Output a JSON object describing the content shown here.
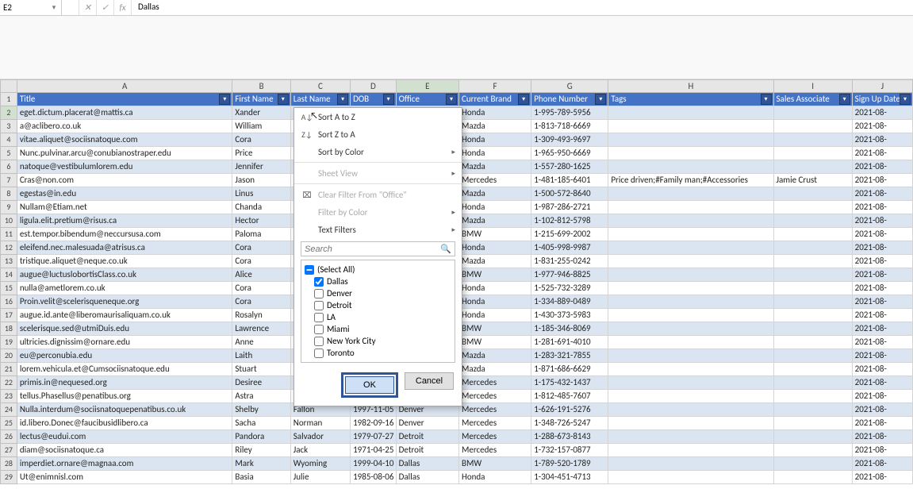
{
  "formula": {
    "name_box": "E2",
    "value": "Dallas"
  },
  "columns": [
    "A",
    "B",
    "C",
    "D",
    "E",
    "F",
    "G",
    "H",
    "I",
    "J"
  ],
  "headers": [
    "Title",
    "First Name",
    "Last Name",
    "DOB",
    "Office",
    "Current Brand",
    "Phone Number",
    "Tags",
    "Sales Associate",
    "Sign Up Date"
  ],
  "rows": [
    {
      "n": 2,
      "title": "eget.dictum.placerat@mattis.ca",
      "fn": "Xander",
      "ln": "",
      "dob": "",
      "off": "",
      "brand": "Honda",
      "ph": "1-995-789-5956",
      "tags": "",
      "sa": "",
      "su": "2021-08-"
    },
    {
      "n": 3,
      "title": "a@aclibero.co.uk",
      "fn": "William",
      "ln": "",
      "dob": "",
      "off": "",
      "brand": "Mazda",
      "ph": "1-813-718-6669",
      "tags": "",
      "sa": "",
      "su": "2021-08-"
    },
    {
      "n": 4,
      "title": "vitae.aliquet@sociisnatoque.com",
      "fn": "Cora",
      "ln": "",
      "dob": "",
      "off": "",
      "brand": "Honda",
      "ph": "1-309-493-9697",
      "tags": "",
      "sa": "",
      "su": "2021-08-"
    },
    {
      "n": 5,
      "title": "Nunc.pulvinar.arcu@conubianostraper.edu",
      "fn": "Price",
      "ln": "",
      "dob": "",
      "off": "",
      "brand": "Honda",
      "ph": "1-965-950-6669",
      "tags": "",
      "sa": "",
      "su": "2021-08-"
    },
    {
      "n": 6,
      "title": "natoque@vestibulumlorem.edu",
      "fn": "Jennifer",
      "ln": "",
      "dob": "",
      "off": "",
      "brand": "Mazda",
      "ph": "1-557-280-1625",
      "tags": "",
      "sa": "",
      "su": "2021-08-"
    },
    {
      "n": 7,
      "title": "Cras@non.com",
      "fn": "Jason",
      "ln": "",
      "dob": "",
      "off": "",
      "brand": "Mercedes",
      "ph": "1-481-185-6401",
      "tags": "Price driven;#Family man;#Accessories",
      "sa": "Jamie Crust",
      "su": "2021-08-"
    },
    {
      "n": 8,
      "title": "egestas@in.edu",
      "fn": "Linus",
      "ln": "",
      "dob": "",
      "off": "",
      "brand": "Mazda",
      "ph": "1-500-572-8640",
      "tags": "",
      "sa": "",
      "su": "2021-08-"
    },
    {
      "n": 9,
      "title": "Nullam@Etiam.net",
      "fn": "Chanda",
      "ln": "",
      "dob": "",
      "off": "",
      "brand": "Honda",
      "ph": "1-987-286-2721",
      "tags": "",
      "sa": "",
      "su": "2021-08-"
    },
    {
      "n": 10,
      "title": "ligula.elit.pretium@risus.ca",
      "fn": "Hector",
      "ln": "",
      "dob": "",
      "off": "",
      "brand": "Mazda",
      "ph": "1-102-812-5798",
      "tags": "",
      "sa": "",
      "su": "2021-08-"
    },
    {
      "n": 11,
      "title": "est.tempor.bibendum@neccursusa.com",
      "fn": "Paloma",
      "ln": "",
      "dob": "",
      "off": "",
      "brand": "BMW",
      "ph": "1-215-699-2002",
      "tags": "",
      "sa": "",
      "su": "2021-08-"
    },
    {
      "n": 12,
      "title": "eleifend.nec.malesuada@atrisus.ca",
      "fn": "Cora",
      "ln": "",
      "dob": "",
      "off": "",
      "brand": "Honda",
      "ph": "1-405-998-9987",
      "tags": "",
      "sa": "",
      "su": "2021-08-"
    },
    {
      "n": 13,
      "title": "tristique.aliquet@neque.co.uk",
      "fn": "Cora",
      "ln": "",
      "dob": "",
      "off": "",
      "brand": "Mazda",
      "ph": "1-831-255-0242",
      "tags": "",
      "sa": "",
      "su": "2021-08-"
    },
    {
      "n": 14,
      "title": "augue@luctuslobortisClass.co.uk",
      "fn": "Alice",
      "ln": "",
      "dob": "",
      "off": "",
      "brand": "BMW",
      "ph": "1-977-946-8825",
      "tags": "",
      "sa": "",
      "su": "2021-08-"
    },
    {
      "n": 15,
      "title": "nulla@ametlorem.co.uk",
      "fn": "Cora",
      "ln": "",
      "dob": "",
      "off": "",
      "brand": "Honda",
      "ph": "1-525-732-3289",
      "tags": "",
      "sa": "",
      "su": "2021-08-"
    },
    {
      "n": 16,
      "title": "Proin.velit@scelerisqueneque.org",
      "fn": "Cora",
      "ln": "",
      "dob": "",
      "off": "",
      "brand": "Honda",
      "ph": "1-334-889-0489",
      "tags": "",
      "sa": "",
      "su": "2021-08-"
    },
    {
      "n": 17,
      "title": "augue.id.ante@liberomaurisaliquam.co.uk",
      "fn": "Rosalyn",
      "ln": "",
      "dob": "",
      "off": "",
      "brand": "Honda",
      "ph": "1-430-373-5983",
      "tags": "",
      "sa": "",
      "su": "2021-08-"
    },
    {
      "n": 18,
      "title": "scelerisque.sed@utmiDuis.edu",
      "fn": "Lawrence",
      "ln": "",
      "dob": "",
      "off": "",
      "brand": "BMW",
      "ph": "1-185-346-8069",
      "tags": "",
      "sa": "",
      "su": "2021-08-"
    },
    {
      "n": 19,
      "title": "ultricies.dignissim@ornare.edu",
      "fn": "Anne",
      "ln": "",
      "dob": "",
      "off": "",
      "brand": "BMW",
      "ph": "1-281-691-4010",
      "tags": "",
      "sa": "",
      "su": "2021-08-"
    },
    {
      "n": 20,
      "title": "eu@perconubia.edu",
      "fn": "Laith",
      "ln": "",
      "dob": "",
      "off": "",
      "brand": "Mazda",
      "ph": "1-283-321-7855",
      "tags": "",
      "sa": "",
      "su": "2021-08-"
    },
    {
      "n": 21,
      "title": "lorem.vehicula.et@Cumsociisnatoque.edu",
      "fn": "Stuart",
      "ln": "",
      "dob": "",
      "off": "",
      "brand": "Mazda",
      "ph": "1-871-686-6629",
      "tags": "",
      "sa": "",
      "su": "2021-08-"
    },
    {
      "n": 22,
      "title": "primis.in@nequesed.org",
      "fn": "Desiree",
      "ln": "",
      "dob": "",
      "off": "",
      "brand": "Mercedes",
      "ph": "1-175-432-1437",
      "tags": "",
      "sa": "",
      "su": "2021-08-"
    },
    {
      "n": 23,
      "title": "tellus.Phasellus@penatibus.org",
      "fn": "Astra",
      "ln": "",
      "dob": "",
      "off": "",
      "brand": "Mercedes",
      "ph": "1-812-485-7607",
      "tags": "",
      "sa": "",
      "su": "2021-08-"
    },
    {
      "n": 24,
      "title": "Nulla.interdum@sociisnatoquepenatibus.co.uk",
      "fn": "Shelby",
      "ln": "Fallon",
      "dob": "1997-11-05",
      "off": "Denver",
      "brand": "Mercedes",
      "ph": "1-626-191-5276",
      "tags": "",
      "sa": "",
      "su": "2021-08-"
    },
    {
      "n": 25,
      "title": "id.libero.Donec@faucibusidlibero.ca",
      "fn": "Sacha",
      "ln": "Norman",
      "dob": "1982-09-16",
      "off": "Denver",
      "brand": "Mercedes",
      "ph": "1-348-726-5247",
      "tags": "",
      "sa": "",
      "su": "2021-08-"
    },
    {
      "n": 26,
      "title": "lectus@eudui.com",
      "fn": "Pandora",
      "ln": "Salvador",
      "dob": "1979-07-27",
      "off": "Detroit",
      "brand": "Mercedes",
      "ph": "1-288-673-8143",
      "tags": "",
      "sa": "",
      "su": "2021-08-"
    },
    {
      "n": 27,
      "title": "diam@sociisnatoque.ca",
      "fn": "Riley",
      "ln": "Jack",
      "dob": "1971-04-25",
      "off": "Detroit",
      "brand": "Mercedes",
      "ph": "1-732-157-0877",
      "tags": "",
      "sa": "",
      "su": "2021-08-"
    },
    {
      "n": 28,
      "title": "imperdiet.ornare@magnaa.com",
      "fn": "Mark",
      "ln": "Wyoming",
      "dob": "1999-04-10",
      "off": "Dallas",
      "brand": "BMW",
      "ph": "1-789-520-1789",
      "tags": "",
      "sa": "",
      "su": "2021-08-"
    },
    {
      "n": 29,
      "title": "Ut@enimnisl.com",
      "fn": "Basia",
      "ln": "Julie",
      "dob": "1985-08-06",
      "off": "Dallas",
      "brand": "Honda",
      "ph": "1-304-451-4713",
      "tags": "",
      "sa": "",
      "su": "2021-08-"
    }
  ],
  "filter_menu": {
    "sort_az": "Sort A to Z",
    "sort_za": "Sort Z to A",
    "sort_color": "Sort by Color",
    "sheet_view": "Sheet View",
    "clear": "Clear Filter From \"Office\"",
    "filter_color": "Filter by Color",
    "text_filters": "Text Filters",
    "search_placeholder": "Search",
    "items": [
      {
        "label": "(Select All)",
        "checked": false,
        "indeterminate": true
      },
      {
        "label": "Dallas",
        "checked": true
      },
      {
        "label": "Denver",
        "checked": false
      },
      {
        "label": "Detroit",
        "checked": false
      },
      {
        "label": "LA",
        "checked": false
      },
      {
        "label": "Miami",
        "checked": false
      },
      {
        "label": "New York City",
        "checked": false
      },
      {
        "label": "Toronto",
        "checked": false
      }
    ],
    "ok": "OK",
    "cancel": "Cancel"
  }
}
